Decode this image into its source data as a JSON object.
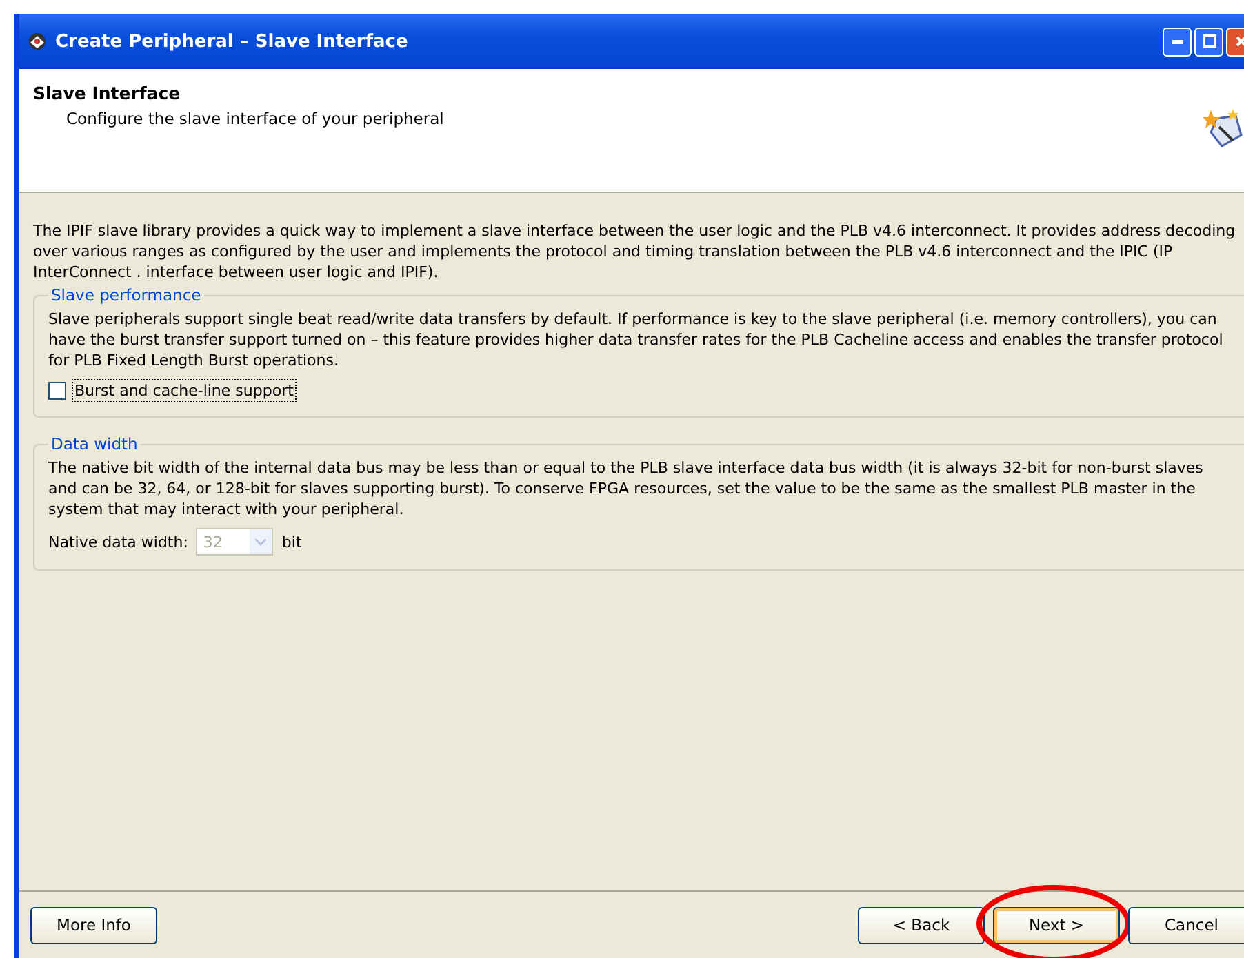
{
  "window": {
    "title": "Create Peripheral – Slave Interface"
  },
  "header": {
    "title": "Slave Interface",
    "subtitle": "Configure the slave interface of your peripheral"
  },
  "intro": "The IPIF slave library provides a quick way to implement a slave interface between the user logic and the PLB v4.6 interconnect. It provides address decoding over various ranges as configured by the user and implements the protocol and timing translation between the PLB v4.6 interconnect and the IPIC (IP InterConnect . interface between user logic and IPIF).",
  "groups": [
    {
      "kind": "checkbox",
      "legend": "Slave performance",
      "text": "Slave peripherals support single beat read/write data transfers by default. If performance is key to the slave peripheral (i.e. memory controllers), you can have the burst transfer support turned on – this feature provides higher data transfer rates for the PLB Cacheline access and enables the transfer protocol for PLB Fixed Length Burst operations.",
      "checkbox": {
        "label": "Burst and cache-line support",
        "checked": false
      }
    },
    {
      "kind": "dropdown",
      "legend": "Data width",
      "text": "The native bit width of the internal data bus may be less than or equal to the PLB slave interface data bus width (it is always 32-bit for non-burst slaves and can be 32, 64, or 128-bit for slaves supporting burst). To conserve FPGA resources, set the value to be the same as the smallest PLB master in the system that may interact with your peripheral.",
      "dropdown": {
        "label": "Native data width:",
        "value": "32",
        "unit": "bit",
        "disabled": true
      }
    }
  ],
  "buttons": [
    {
      "label": "More Info",
      "kind": "left",
      "highlighted": false
    },
    {
      "label": "< Back",
      "kind": "right",
      "highlighted": false
    },
    {
      "label": "Next >",
      "kind": "right",
      "highlighted": true
    },
    {
      "label": "Cancel",
      "kind": "right",
      "highlighted": false
    }
  ]
}
